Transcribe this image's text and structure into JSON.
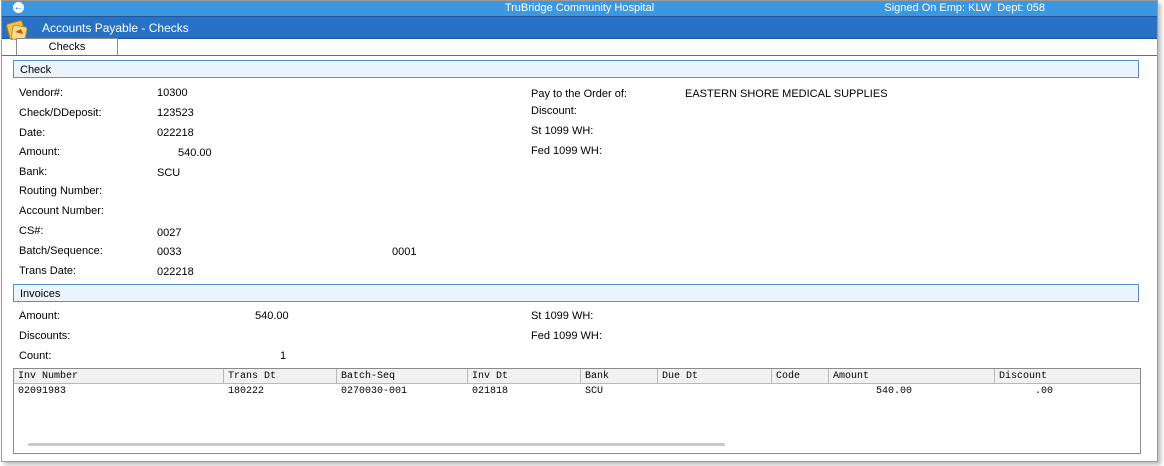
{
  "topbar": {
    "title": "TruBridge Community Hospital",
    "user": "Signed On Emp: KLW  Dept: 058"
  },
  "app": {
    "title": "Accounts Payable - Checks"
  },
  "tabs": {
    "checks": "Checks"
  },
  "check": {
    "section_title": "Check",
    "vendor_label": "Vendor#:",
    "vendor": "10300",
    "check_label": "Check/DDeposit:",
    "check": "123523",
    "date_label": "Date:",
    "date": "022218",
    "amount_label": "Amount:",
    "amount": "540.00",
    "bank_label": "Bank:",
    "bank": "SCU",
    "routing_label": "Routing Number:",
    "account_label": "Account Number:",
    "cs_label": "CS#:",
    "cs": "0027",
    "batch_label": "Batch/Sequence:",
    "batch": "0033",
    "sequence": "0001",
    "trans_label": "Trans Date:",
    "trans": "022218",
    "payto_label": "Pay to the Order of:",
    "payto": "EASTERN SHORE MEDICAL SUPPLIES",
    "discount_label": "Discount:",
    "st1099_label": "St 1099 WH:",
    "fed1099_label": "Fed 1099 WH:"
  },
  "invoices": {
    "section_title": "Invoices",
    "amount_label": "Amount:",
    "amount": "540.00",
    "discounts_label": "Discounts:",
    "count_label": "Count:",
    "count": "1",
    "st1099_label": "St 1099 WH:",
    "fed1099_label": "Fed 1099 WH:"
  },
  "grid": {
    "columns": [
      "Inv Number",
      "Trans Dt",
      "Batch-Seq",
      "Inv Dt",
      "Bank",
      "Due Dt",
      "Code",
      "Amount",
      "Discount"
    ],
    "row": {
      "inv_number": "02091983",
      "trans_dt": "180222",
      "batch_seq": "0270030-001",
      "inv_dt": "021818",
      "bank": "SCU",
      "due_dt": "",
      "code": "",
      "amount": "540.00",
      "discount": ".00"
    }
  }
}
